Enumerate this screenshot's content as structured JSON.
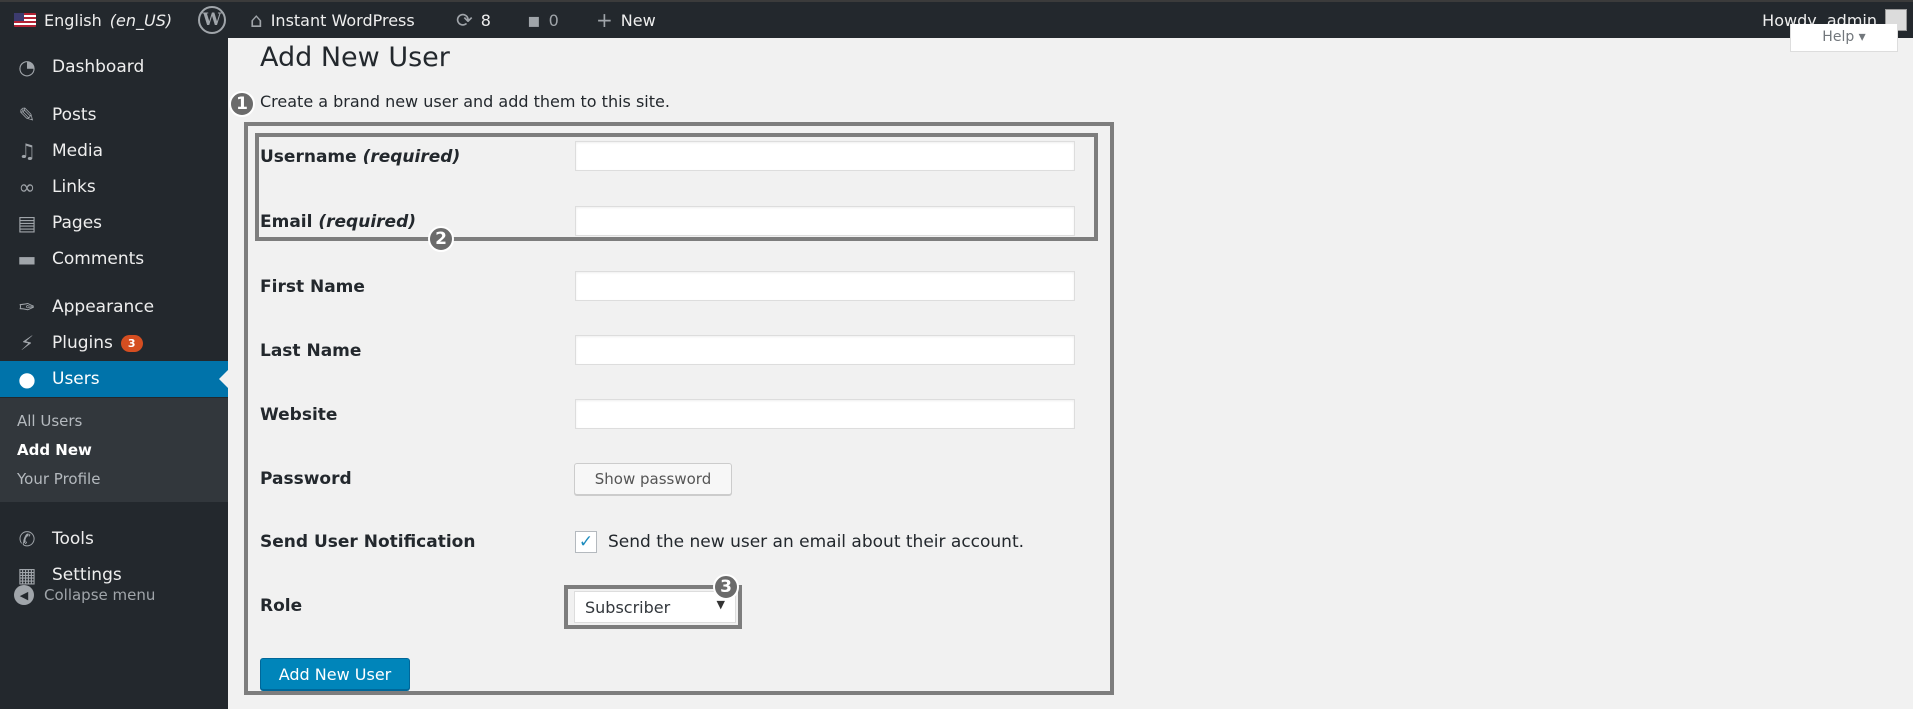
{
  "adminbar": {
    "language_prefix": "English",
    "language_code": "(en_US)",
    "site_name": "Instant WordPress",
    "updates_count": "8",
    "comments_count": "0",
    "new_label": "New",
    "howdy": "Howdy, admin"
  },
  "sidebar": {
    "items": [
      {
        "label": "Dashboard",
        "icon": "dashboard-icon"
      },
      {
        "label": "Posts",
        "icon": "pushpin-icon"
      },
      {
        "label": "Media",
        "icon": "media-icon"
      },
      {
        "label": "Links",
        "icon": "link-icon"
      },
      {
        "label": "Pages",
        "icon": "pages-icon"
      },
      {
        "label": "Comments",
        "icon": "comment-icon"
      },
      {
        "label": "Appearance",
        "icon": "paintbrush-icon"
      },
      {
        "label": "Plugins",
        "icon": "plugin-icon",
        "badge": "3"
      },
      {
        "label": "Users",
        "icon": "user-icon"
      },
      {
        "label": "Tools",
        "icon": "wrench-icon"
      },
      {
        "label": "Settings",
        "icon": "settings-icon"
      }
    ],
    "users_submenu": [
      "All Users",
      "Add New",
      "Your Profile"
    ],
    "collapse_label": "Collapse menu"
  },
  "main": {
    "help_label": "Help ▾",
    "title": "Add New User",
    "description": "Create a brand new user and add them to this site.",
    "markers": [
      "1",
      "2",
      "3"
    ],
    "fields": {
      "username_label": "Username",
      "email_label": "Email",
      "required_suffix": "(required)",
      "first_name_label": "First Name",
      "last_name_label": "Last Name",
      "website_label": "Website",
      "password_label": "Password",
      "show_password": "Show password",
      "notification_label": "Send User Notification",
      "notification_text": "Send the new user an email about their account.",
      "notification_checked": true,
      "role_label": "Role",
      "role_value": "Subscriber"
    },
    "submit_label": "Add New User"
  },
  "colors": {
    "adminbar_bg": "#23282d",
    "menu_current": "#0073aa",
    "button_primary": "#0085ba",
    "badge": "#d54e21",
    "annotation": "#7d7d7d"
  }
}
